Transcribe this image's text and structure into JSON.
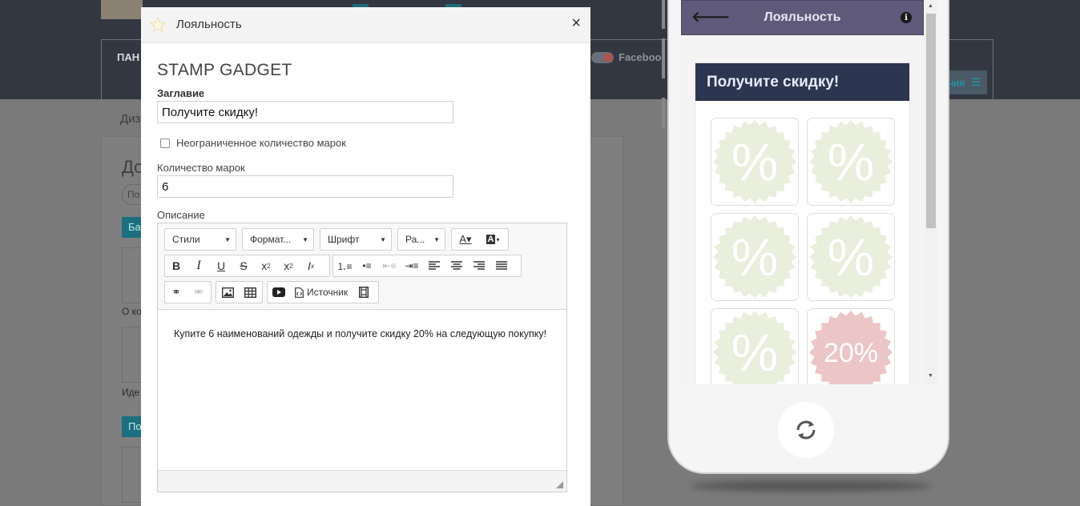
{
  "background": {
    "panel_title": "ПАН",
    "facebook_label": "Faceboo",
    "menu_label": "ния",
    "tab_label": "Диз",
    "heading": "До",
    "pill_label": "По",
    "teal_bar_1": "Ба",
    "teal_bar_2": "По",
    "text_1": "О ко",
    "text_2": "Иде"
  },
  "modal": {
    "title": "Лояльность",
    "gadget_title": "STAMP GADGET",
    "title_label": "Заглавие",
    "title_value": "Получите скидку!",
    "unlimited_label": "Неограниченное количество марок",
    "unlimited_checked": false,
    "count_label": "Количество марок",
    "count_value": "6",
    "description_label": "Описание",
    "description_text": "Купите 6 наименований одежды и получите скидку 20% на следующую покупку!",
    "toolbar": {
      "styles": "Стили",
      "format": "Формат...",
      "font": "Шрифт",
      "size": "Ра...",
      "source": "Источник"
    }
  },
  "preview": {
    "app_title": "Лояльность",
    "card_title": "Получите скидку!",
    "stamps": [
      {
        "symbol": "%",
        "state": "empty"
      },
      {
        "symbol": "%",
        "state": "empty"
      },
      {
        "symbol": "%",
        "state": "empty"
      },
      {
        "symbol": "%",
        "state": "empty"
      },
      {
        "symbol": "%",
        "state": "empty"
      },
      {
        "symbol": "20%",
        "state": "reward"
      }
    ],
    "colors": {
      "app_bar": "#5f5a7a",
      "card_header": "#2c3650",
      "stamp_empty": "#e9eedd",
      "stamp_reward": "#ecc5c6"
    }
  }
}
